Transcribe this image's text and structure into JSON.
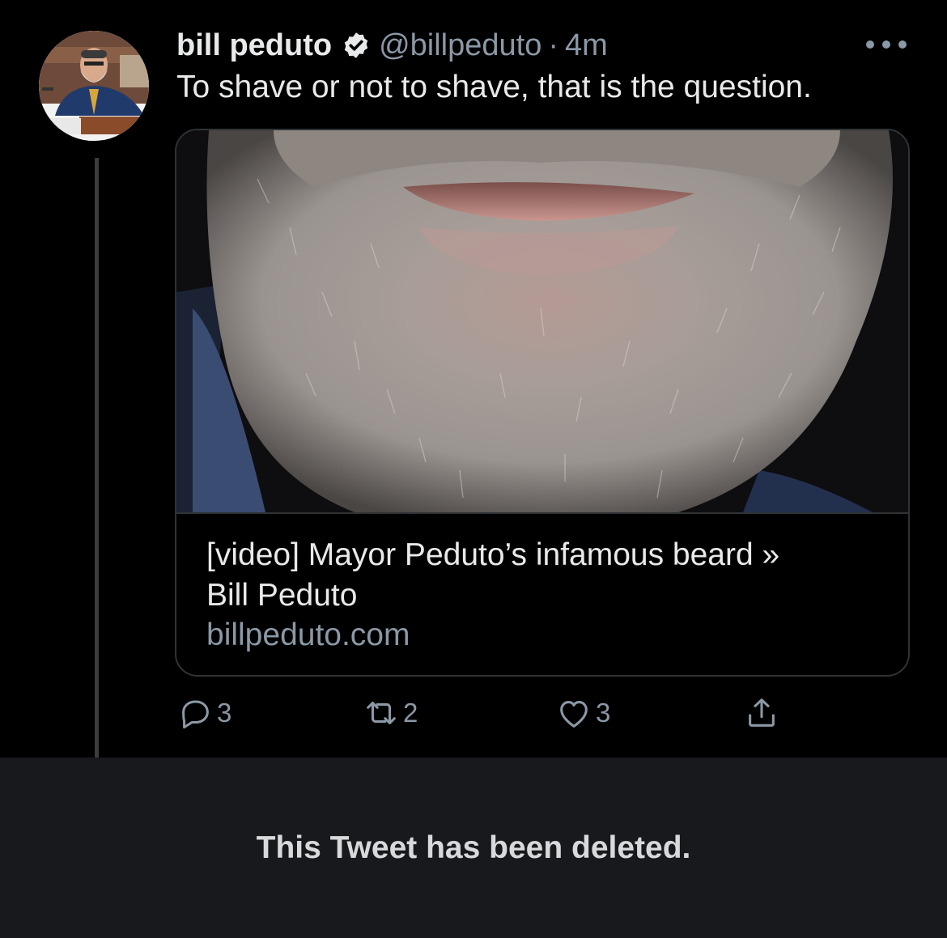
{
  "tweet": {
    "author_name": "bill peduto",
    "handle": "@billpeduto",
    "separator": "·",
    "time": "4m",
    "text": "To shave or not to shave, that is the question.",
    "verified_icon": "verified-badge-icon",
    "more_icon": "more-dots-icon",
    "card": {
      "image_alt": "beard-photo",
      "title_line1": "[video] Mayor Peduto’s infamous beard »",
      "title_line2": "Bill Peduto",
      "domain": "billpeduto.com"
    },
    "actions": {
      "reply_count": "3",
      "retweet_count": "2",
      "like_count": "3"
    }
  },
  "deleted_notice": "This Tweet has been deleted.",
  "colors": {
    "background": "#000000",
    "primary_text": "#e7e9ea",
    "secondary_text": "#8b98a5",
    "deleted_panel": "#18191c"
  }
}
